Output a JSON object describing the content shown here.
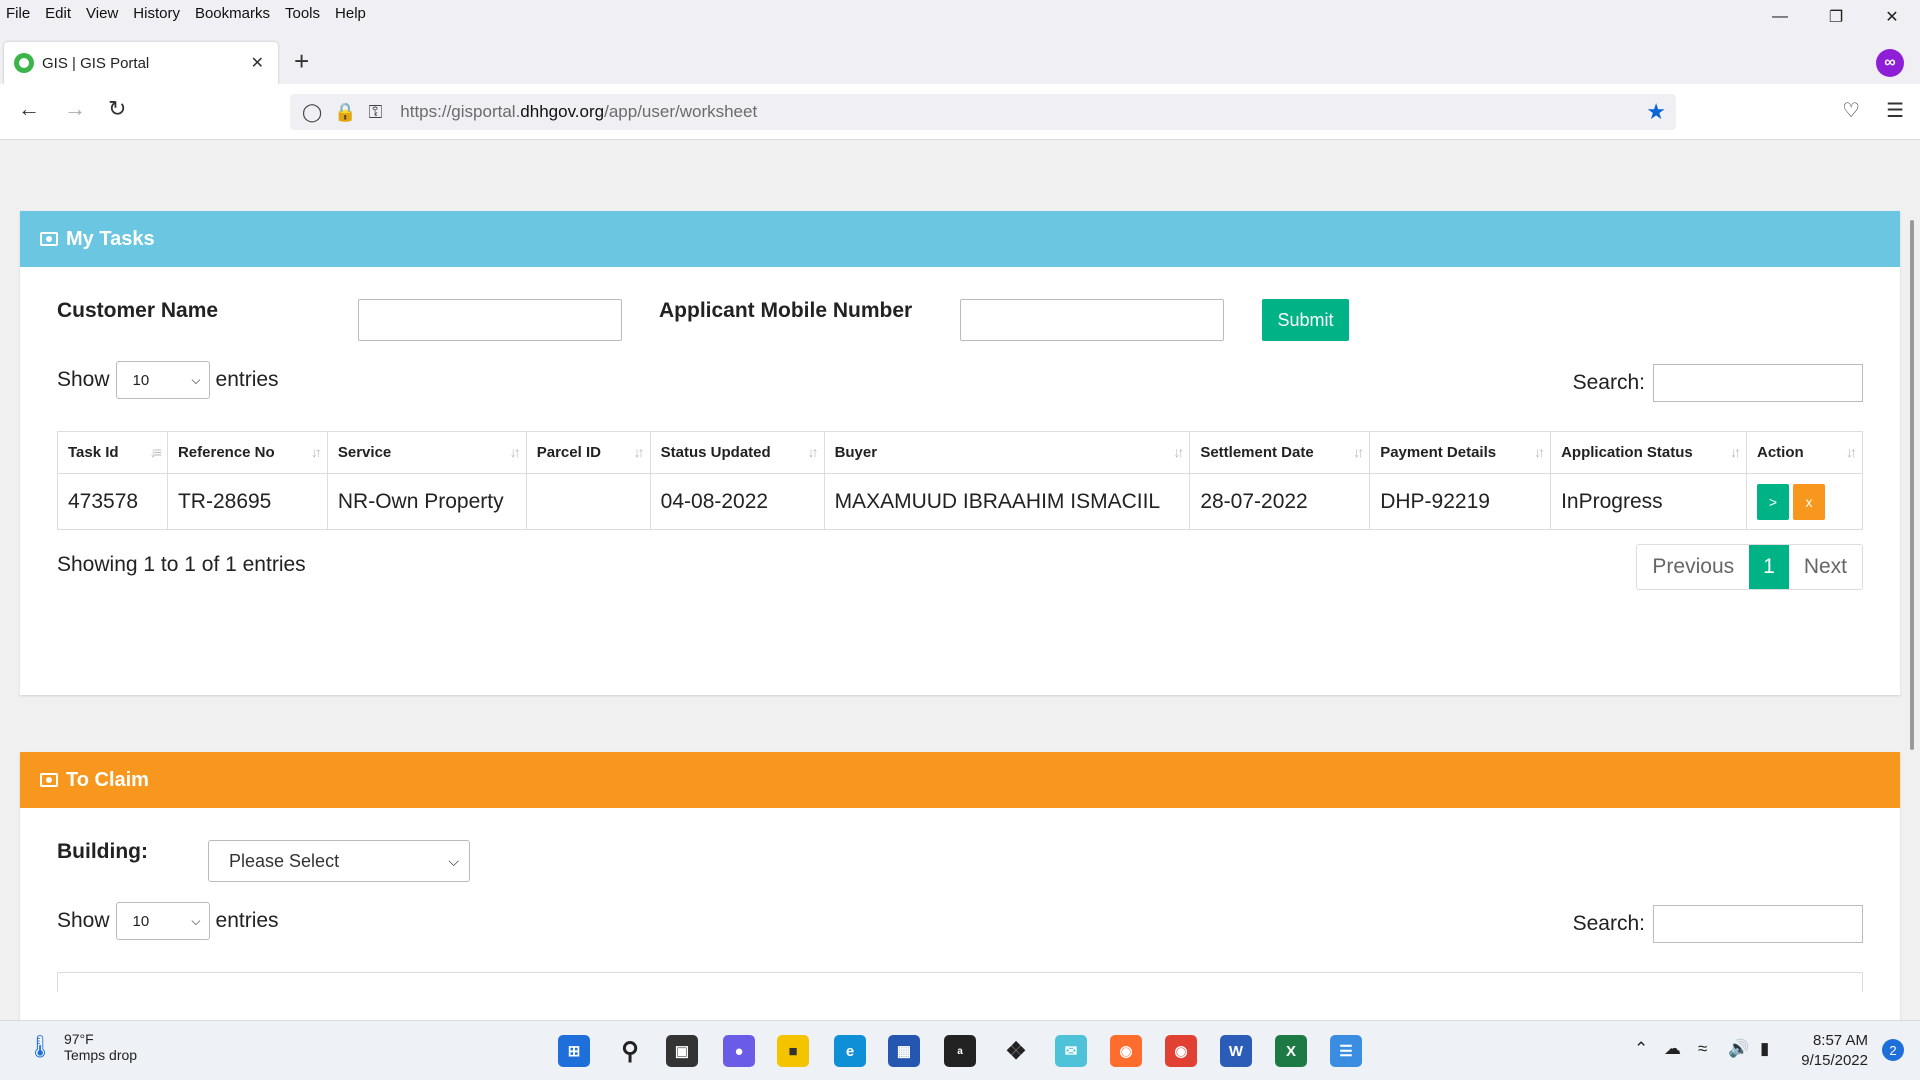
{
  "menu": [
    "File",
    "Edit",
    "View",
    "History",
    "Bookmarks",
    "Tools",
    "Help"
  ],
  "tab": {
    "title": "GIS | GIS Portal"
  },
  "url": {
    "prefix": "https://gisportal.",
    "domain": "dhhgov.org",
    "path": "/app/user/worksheet"
  },
  "tasks": {
    "title": "My Tasks",
    "customer_label": "Customer Name",
    "mobile_label": "Applicant Mobile Number",
    "submit": "Submit",
    "show": "Show",
    "entries_count": "10",
    "entries": "entries",
    "search": "Search:",
    "columns": [
      "Task Id",
      "Reference No",
      "Service",
      "Parcel ID",
      "Status Updated",
      "Buyer",
      "Settlement Date",
      "Payment Details",
      "Application Status",
      "Action"
    ],
    "row": {
      "task_id": "473578",
      "reference": "TR-28695",
      "service": "NR-Own Property",
      "parcel": "",
      "status_updated": "04-08-2022",
      "buyer": "MAXAMUUD IBRAAHIM ISMACIIL",
      "settlement": "28-07-2022",
      "payment": "DHP-92219",
      "app_status": "InProgress",
      "act_go": ">",
      "act_del": "x"
    },
    "info": "Showing 1 to 1 of 1 entries",
    "prev": "Previous",
    "page": "1",
    "next": "Next"
  },
  "claim": {
    "title": "To Claim",
    "building_label": "Building:",
    "building_value": "Please Select",
    "show": "Show",
    "entries_count": "10",
    "entries": "entries",
    "search": "Search:"
  },
  "taskbar": {
    "temp": "97°F",
    "weather_note": "Temps drop",
    "time": "8:57 AM",
    "date": "9/15/2022",
    "notifications": "2"
  },
  "colors": {
    "info_header": "#6ac6e1",
    "claim_header": "#f7971e",
    "accent_green": "#00b386",
    "accent_orange": "#f7971e"
  }
}
